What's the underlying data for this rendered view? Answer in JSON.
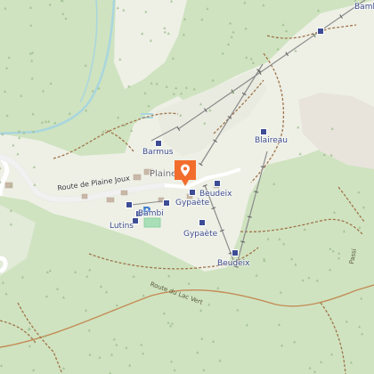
{
  "map": {
    "labels": {
      "barmus": "Barmus",
      "plaine": "Plaine",
      "beudeix_upper": "Beudeix",
      "gypaete_upper": "Gypaète",
      "bambi": "Bambi",
      "lutins": "Lutins",
      "gypaete_lower": "Gypaète",
      "blaireau": "Blaireau",
      "beudeix_lower": "Beudeix",
      "bambi_corner": "Bambi",
      "passi": "Passi"
    },
    "roads": {
      "route_plaine_joux": "Route de Plaine Joux",
      "route_lac_vert": "Route du Lac Vert"
    },
    "parking_symbol": "P",
    "marker_icon": "location-pin-icon",
    "colors": {
      "forest": "#cfe3c0",
      "meadow": "#eef0e6",
      "marker": "#f26d2c",
      "lift": "#8b8b8b",
      "path": "#c48a55",
      "poi": "#3d4c95",
      "stream": "#a9d6de"
    }
  }
}
